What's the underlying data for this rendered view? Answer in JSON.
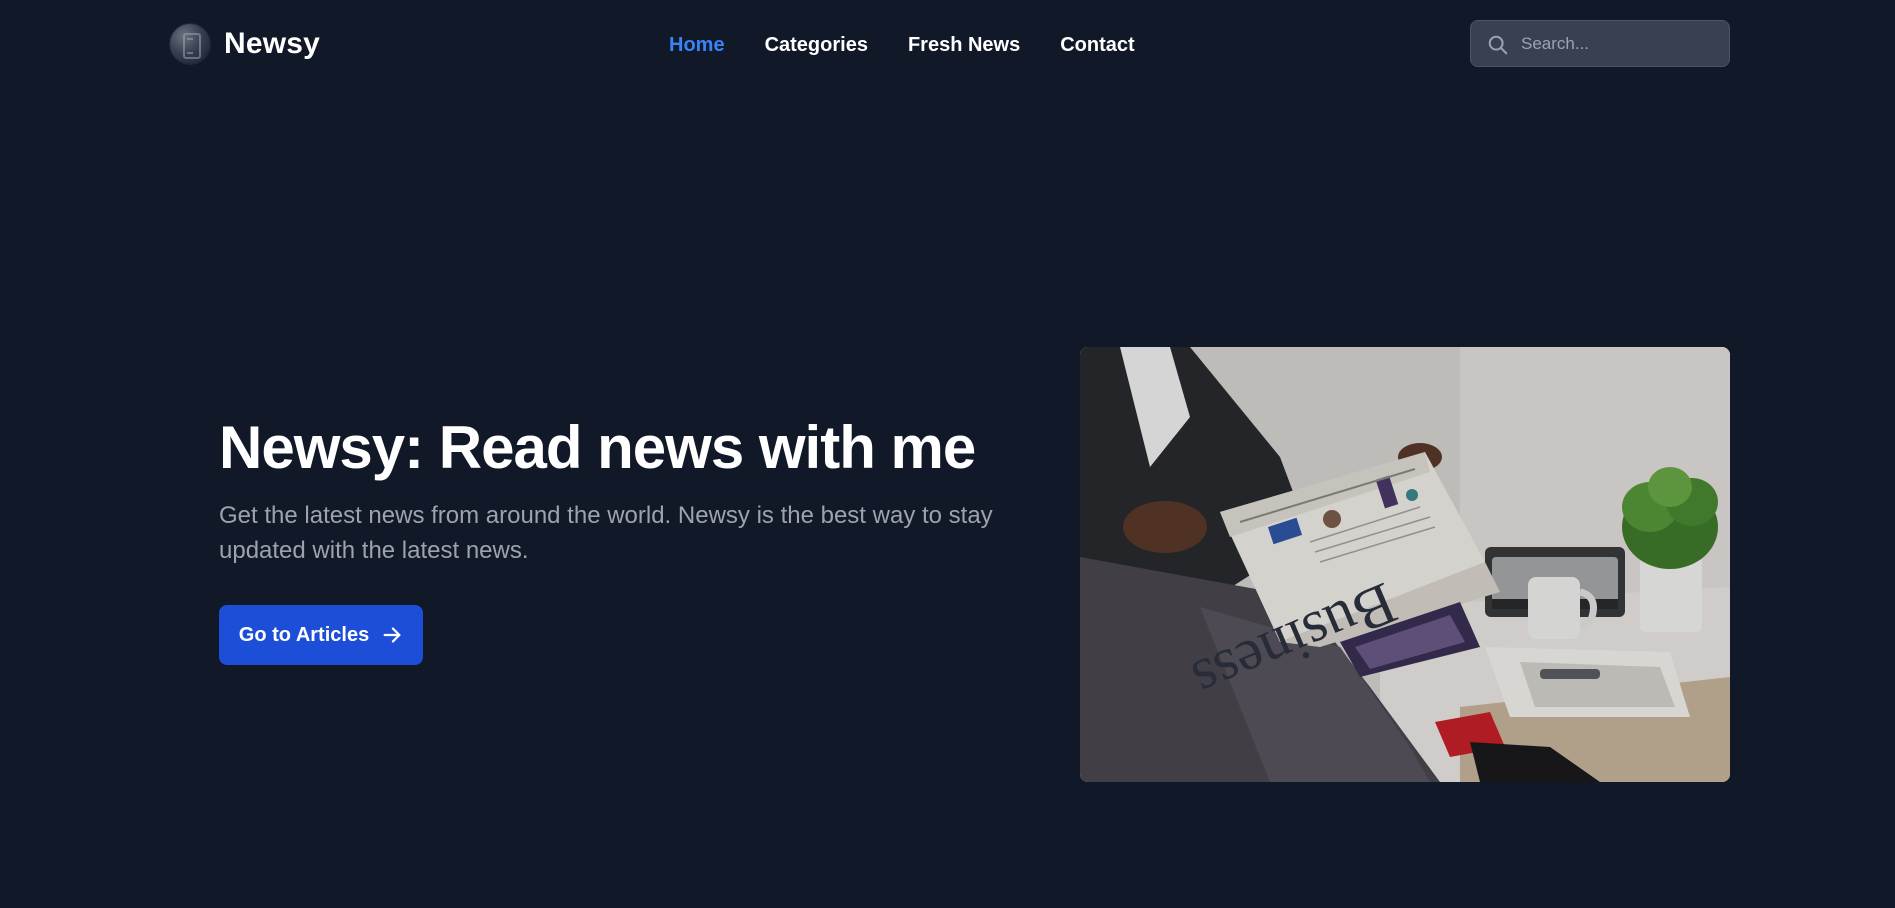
{
  "brand": {
    "name": "Newsy",
    "logo_icon": "newspaper-logo-icon"
  },
  "nav": {
    "items": [
      {
        "label": "Home",
        "active": true
      },
      {
        "label": "Categories",
        "active": false
      },
      {
        "label": "Fresh News",
        "active": false
      },
      {
        "label": "Contact",
        "active": false
      }
    ]
  },
  "search": {
    "placeholder": "Search...",
    "value": "",
    "icon": "search-icon"
  },
  "hero": {
    "title": "Newsy: Read news with me",
    "subtitle": "Get the latest news from around the world. Newsy is the best way to stay updated with the latest news.",
    "cta_label": "Go to Articles",
    "cta_icon": "arrow-right-icon",
    "image_alt": "man-reading-business-newspaper",
    "newspaper_masthead": "Business"
  },
  "colors": {
    "background": "#111827",
    "accent": "#3b82f6",
    "button": "#1d4ed8",
    "muted_text": "#9ca3af",
    "search_bg": "#374151"
  }
}
